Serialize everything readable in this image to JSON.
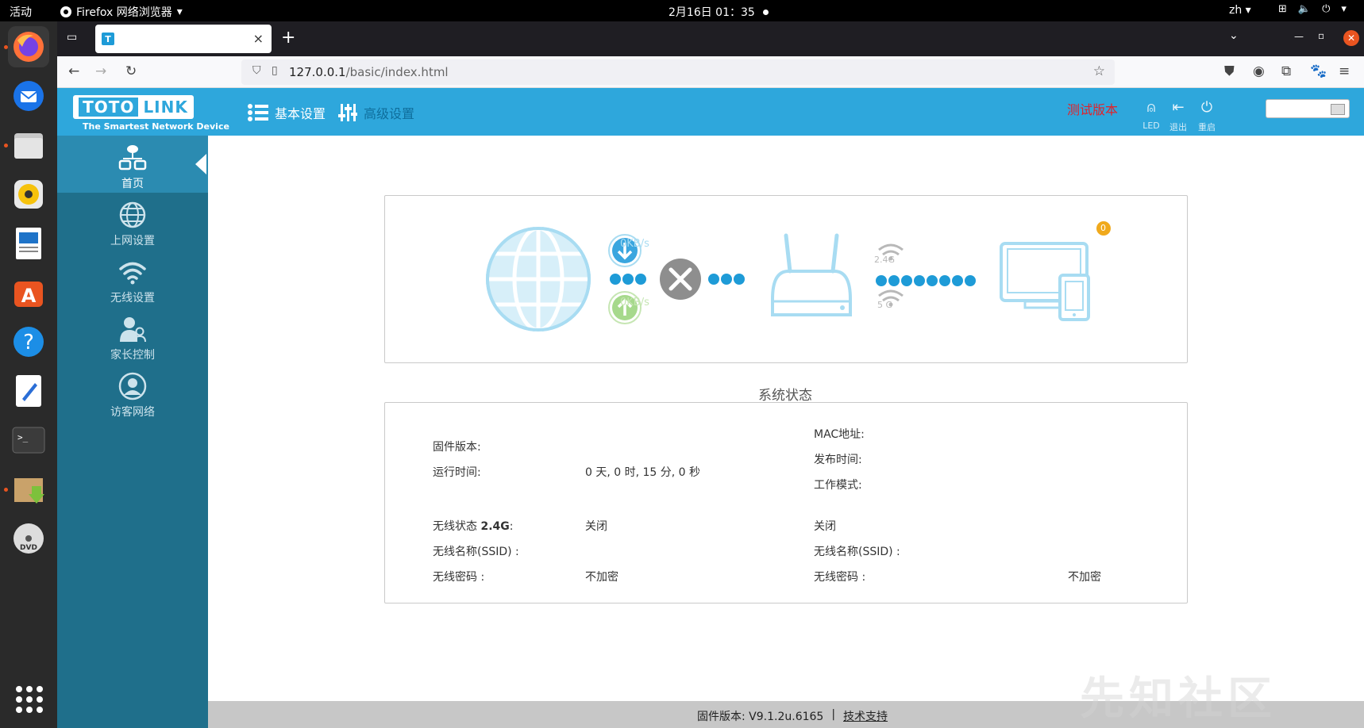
{
  "topbar": {
    "activities": "活动",
    "app_name": "Firefox 网络浏览器",
    "clock": "2月16日  01：35",
    "lang": "zh"
  },
  "browser": {
    "tab_favicon": "T",
    "url_host": "127.0.0.1",
    "url_path": "/basic/index.html"
  },
  "router_header": {
    "logo_left": "TOTO",
    "logo_right": "LINK",
    "tagline": "The Smartest Network Device",
    "menu_basic": "基本设置",
    "menu_advanced": "高级设置",
    "test_version": "测试版本",
    "btn_led": "LED",
    "btn_logout": "退出",
    "btn_reboot": "重启"
  },
  "sidebar": {
    "items": [
      {
        "label": "首页",
        "icon": "home-network-icon"
      },
      {
        "label": "上网设置",
        "icon": "globe-icon"
      },
      {
        "label": "无线设置",
        "icon": "wifi-icon"
      },
      {
        "label": "家长控制",
        "icon": "parental-icon"
      },
      {
        "label": "访客网络",
        "icon": "guest-icon"
      }
    ]
  },
  "diagram": {
    "download_speed": "0KB/s",
    "upload_speed": "0KB/s",
    "band_24": "2.4G",
    "band_5": "5 G",
    "client_count": "0"
  },
  "status": {
    "title": "系统状态",
    "firmware_label": "固件版本:",
    "firmware_value": "",
    "mac_label": "MAC地址:",
    "mac_value": "",
    "release_label": "发布时间:",
    "release_value": "",
    "uptime_label": "运行时间:",
    "uptime_value": "0 天, 0 时, 15 分, 0 秒",
    "mode_label": "工作模式:",
    "mode_value": "",
    "wifi_state_label": "无线状态",
    "wifi_state_band": "2.4G",
    "wifi_state_colon": ":",
    "wifi24_state": "关闭",
    "wifi5_state": "关闭",
    "ssid_label_left": "无线名称(SSID) :",
    "ssid_value_left": "",
    "ssid_label_right": "无线名称(SSID) :",
    "ssid_value_right": "",
    "pwd_label_left": "无线密码 :",
    "pwd_value_left": "不加密",
    "pwd_label_right": "无线密码 :",
    "pwd_value_right": "不加密"
  },
  "footer": {
    "firmware": "固件版本: V9.1.2u.6165",
    "sep": "|",
    "support": "技术支持"
  },
  "watermark": "先知社区",
  "colors": {
    "header_blue": "#2ea7dc",
    "sidebar_teal": "#1f6f8b",
    "sidebar_active": "#2b8bb1",
    "test_red": "#e2222a",
    "diagram_light_blue": "#a8dcf2",
    "dot_blue": "#1e9bd7"
  }
}
